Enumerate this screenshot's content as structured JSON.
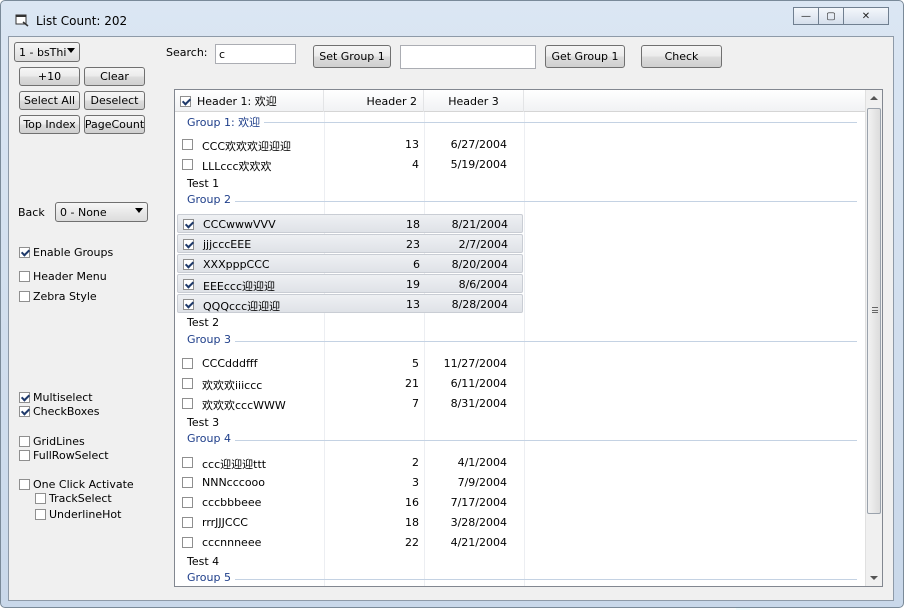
{
  "window": {
    "title": "List Count: 202",
    "controls": {
      "minimize": "—",
      "maximize": "▢",
      "close": "✕"
    }
  },
  "left_panel": {
    "style_combo": "1 - bsThi",
    "plus10": "+10",
    "clear": "Clear",
    "select_all": "Select All",
    "deselect": "Deselect",
    "top_index": "Top Index",
    "page_count": "PageCount",
    "back_label": "Back",
    "back_combo": "0 - None",
    "options": [
      {
        "label": "Enable Groups",
        "checked": true
      },
      {
        "label": "Header Menu",
        "checked": false
      },
      {
        "label": "Zebra Style",
        "checked": false
      },
      {
        "label": "Multiselect",
        "checked": true
      },
      {
        "label": "CheckBoxes",
        "checked": true
      },
      {
        "label": "GridLines",
        "checked": false
      },
      {
        "label": "FullRowSelect",
        "checked": false
      },
      {
        "label": "One Click Activate",
        "checked": false
      },
      {
        "label": "TrackSelect",
        "checked": false
      },
      {
        "label": "UnderlineHot",
        "checked": false
      }
    ]
  },
  "toolbar": {
    "search_label": "Search:",
    "search_value": "c",
    "set_group": "Set Group 1",
    "group_value": "",
    "get_group": "Get Group 1",
    "check": "Check"
  },
  "list": {
    "headers": [
      "Header 1: 欢迎",
      "Header 2",
      "Header 3"
    ],
    "header_checked": true,
    "groups": [
      {
        "title": "Group 1: 欢迎",
        "rows": [
          {
            "name": "CCC欢欢欢迎迎迎",
            "num": "13",
            "date": "6/27/2004",
            "checked": false,
            "selected": false
          },
          {
            "name": "LLLccc欢欢欢",
            "num": "4",
            "date": "5/19/2004",
            "checked": false,
            "selected": false
          }
        ],
        "footer": "Test 1"
      },
      {
        "title": "Group 2",
        "rows": [
          {
            "name": "CCCwwwVVV",
            "num": "18",
            "date": "8/21/2004",
            "checked": true,
            "selected": true
          },
          {
            "name": "jjjcccEEE",
            "num": "23",
            "date": "2/7/2004",
            "checked": true,
            "selected": true
          },
          {
            "name": "XXXpppCCC",
            "num": "6",
            "date": "8/20/2004",
            "checked": true,
            "selected": true
          },
          {
            "name": "EEEccc迎迎迎",
            "num": "19",
            "date": "8/6/2004",
            "checked": true,
            "selected": true
          },
          {
            "name": "QQQccc迎迎迎",
            "num": "13",
            "date": "8/28/2004",
            "checked": true,
            "selected": true
          }
        ],
        "footer": "Test 2"
      },
      {
        "title": "Group 3",
        "rows": [
          {
            "name": "CCCdddfff",
            "num": "5",
            "date": "11/27/2004",
            "checked": false,
            "selected": false
          },
          {
            "name": "欢欢欢iiiccc",
            "num": "21",
            "date": "6/11/2004",
            "checked": false,
            "selected": false
          },
          {
            "name": "欢欢欢cccWWW",
            "num": "7",
            "date": "8/31/2004",
            "checked": false,
            "selected": false
          }
        ],
        "footer": "Test 3"
      },
      {
        "title": "Group 4",
        "rows": [
          {
            "name": "ccc迎迎迎ttt",
            "num": "2",
            "date": "4/1/2004",
            "checked": false,
            "selected": false
          },
          {
            "name": "NNNcccooo",
            "num": "3",
            "date": "7/9/2004",
            "checked": false,
            "selected": false
          },
          {
            "name": "cccbbbeee",
            "num": "16",
            "date": "7/17/2004",
            "checked": false,
            "selected": false
          },
          {
            "name": "rrrJJJCCC",
            "num": "18",
            "date": "3/28/2004",
            "checked": false,
            "selected": false
          },
          {
            "name": "cccnnneee",
            "num": "22",
            "date": "4/21/2004",
            "checked": false,
            "selected": false
          }
        ],
        "footer": "Test 4"
      },
      {
        "title": "Group 5",
        "rows": [],
        "footer": ""
      }
    ]
  }
}
